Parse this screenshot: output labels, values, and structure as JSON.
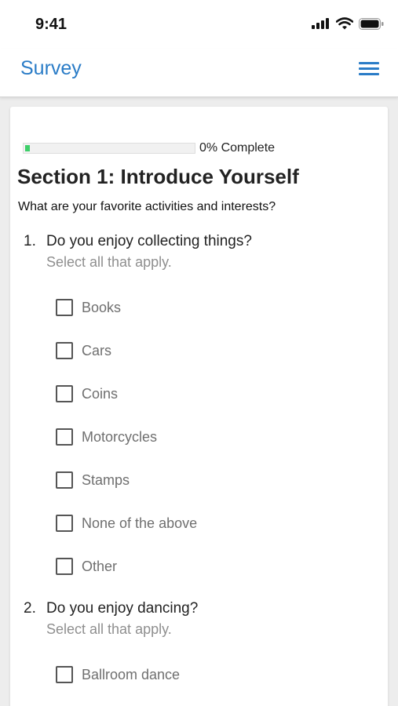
{
  "status": {
    "time": "9:41"
  },
  "nav": {
    "title": "Survey"
  },
  "progress": {
    "label": "0% Complete",
    "fraction": 0.0
  },
  "section": {
    "title": "Section 1: Introduce Yourself",
    "description": "What are your favorite activities and interests?"
  },
  "questions": [
    {
      "number": "1.",
      "text": "Do you enjoy collecting things?",
      "hint": "Select all that apply.",
      "options": [
        "Books",
        "Cars",
        "Coins",
        "Motorcycles",
        "Stamps",
        "None of the above",
        "Other"
      ]
    },
    {
      "number": "2.",
      "text": "Do you enjoy dancing?",
      "hint": "Select all that apply.",
      "options": [
        "Ballroom dance"
      ]
    }
  ],
  "colors": {
    "accent": "#2a7cc7",
    "progress": "#3ecf6a"
  }
}
